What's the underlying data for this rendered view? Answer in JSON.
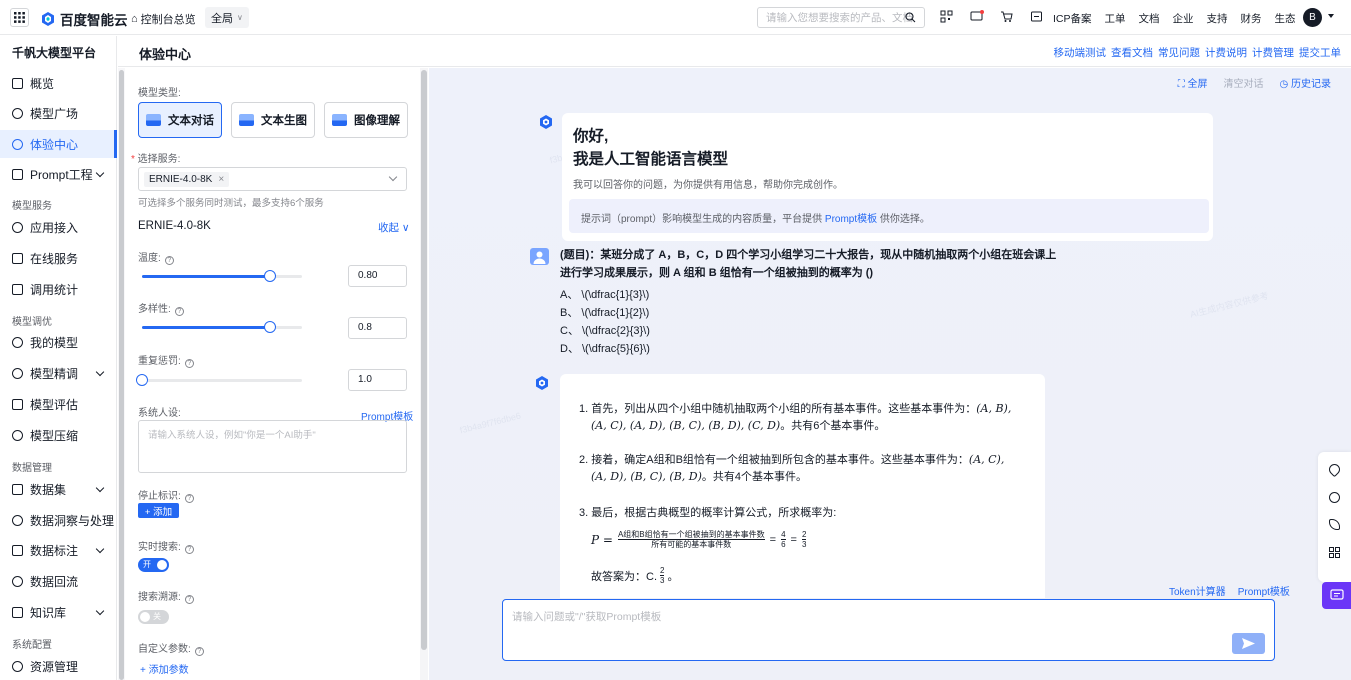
{
  "topbar": {
    "brand": "百度智能云",
    "console_home": "控制台总览",
    "region": "全局",
    "search_placeholder": "请输入您想要搜索的产品、文档",
    "links": [
      "ICP备案",
      "工单",
      "文档",
      "企业",
      "支持",
      "财务",
      "生态"
    ],
    "avatar_letter": "B"
  },
  "sidebar": {
    "platform": "千帆大模型平台",
    "items": [
      {
        "label": "概览"
      },
      {
        "label": "模型广场"
      },
      {
        "label": "体验中心",
        "active": true
      },
      {
        "label": "Prompt工程",
        "expandable": true
      },
      {
        "group": "模型服务"
      },
      {
        "label": "应用接入"
      },
      {
        "label": "在线服务"
      },
      {
        "label": "调用统计"
      },
      {
        "group": "模型调优"
      },
      {
        "label": "我的模型"
      },
      {
        "label": "模型精调",
        "expandable": true
      },
      {
        "label": "模型评估"
      },
      {
        "label": "模型压缩"
      },
      {
        "group": "数据管理"
      },
      {
        "label": "数据集",
        "expandable": true
      },
      {
        "label": "数据洞察与处理"
      },
      {
        "label": "数据标注",
        "expandable": true
      },
      {
        "label": "数据回流"
      },
      {
        "label": "知识库",
        "expandable": true
      },
      {
        "group": "系统配置"
      },
      {
        "label": "资源管理"
      }
    ]
  },
  "header": {
    "title": "体验中心",
    "links": [
      "移动端测试",
      "查看文档",
      "常见问题",
      "计费说明",
      "计费管理",
      "提交工单"
    ]
  },
  "settings": {
    "model_type_label": "模型类型:",
    "types": [
      "文本对话",
      "文本生图",
      "图像理解"
    ],
    "service_label": "选择服务:",
    "selected_service": "ERNIE-4.0-8K",
    "service_hint": "可选择多个服务同时测试，最多支持6个服务",
    "model_name": "ERNIE-4.0-8K",
    "collapse": "收起",
    "temperature_label": "温度:",
    "temperature": "0.80",
    "temperature_fraction": 0.8,
    "diversity_label": "多样性:",
    "diversity": "0.8",
    "diversity_fraction": 0.8,
    "penalty_label": "重复惩罚:",
    "penalty": "1.0",
    "penalty_fraction": 0.0,
    "system_label": "系统人设:",
    "prompt_template": "Prompt模板",
    "system_placeholder": "请输入系统人设，例如\"你是一个AI助手\"",
    "stop_label": "停止标识:",
    "add": "+ 添加",
    "realtime_label": "实时搜索:",
    "realtime_on": "开",
    "trace_label": "搜索溯源:",
    "trace_off": "关",
    "custom_label": "自定义参数:",
    "add_param": "+ 添加参数"
  },
  "chat": {
    "tools": {
      "fullscreen": "全屏",
      "clear": "清空对话",
      "history": "历史记录"
    },
    "greeting": {
      "hello": "你好,",
      "sub": "我是人工智能语言模型",
      "desc": "我可以回答你的问题，为你提供有用信息，帮助你完成创作。",
      "tip_prefix": "提示词（prompt）影响模型生成的内容质量，平台提供",
      "tip_link": "Prompt模板",
      "tip_suffix": "供你选择。"
    },
    "question": {
      "line1": "(题目)：某班分成了 A，B，C，D 四个学习小组学习二十大报告，现从中随机抽取两个小组在班会课上",
      "line2": "进行学习成果展示，则 A 组和 B 组恰有一个组被抽到的概率为 ()",
      "options": [
        "A、 \\(\\dfrac{1}{3}\\)",
        "B、 \\(\\dfrac{1}{2}\\)",
        "C、 \\(\\dfrac{2}{3}\\)",
        "D、 \\(\\dfrac{5}{6}\\)"
      ]
    },
    "answer": {
      "s1a": "1. 首先，列出从四个小组中随机抽取两个小组的所有基本事件。这些基本事件为：",
      "s1b": "(A, B),",
      "s1c": "(A, C), (A, D), (B, C), (B, D), (C, D)",
      "s1d": "。共有6个基本事件。",
      "s2a": "2. 接着，确定A组和B组恰有一个组被抽到所包含的基本事件。这些基本事件为：",
      "s2b": "(A, C),",
      "s2c": "(A, D), (B, C), (B, D)",
      "s2d": "。共有4个基本事件。",
      "s3": "3. 最后，根据古典概型的概率计算公式，所求概率为:",
      "p": "P =",
      "frac_num": "A组和B组恰有一个组被抽到的基本事件数",
      "frac_den": "所有可能的基本事件数",
      "eq1": "=",
      "n1": "4",
      "d1": "6",
      "eq2": "=",
      "n2": "2",
      "d2": "3",
      "final_prefix": "故答案为：C.",
      "final_n": "2",
      "final_d": "3",
      "final_suffix": "。"
    },
    "token_calc": "Token计算器",
    "prompt_tpl": "Prompt模板",
    "input_placeholder": "请输入问题或\"/\"获取Prompt模板"
  },
  "colors": {
    "accent": "#2468f2",
    "chat_bg": "#eef1fa",
    "purple": "#6b36f7"
  }
}
